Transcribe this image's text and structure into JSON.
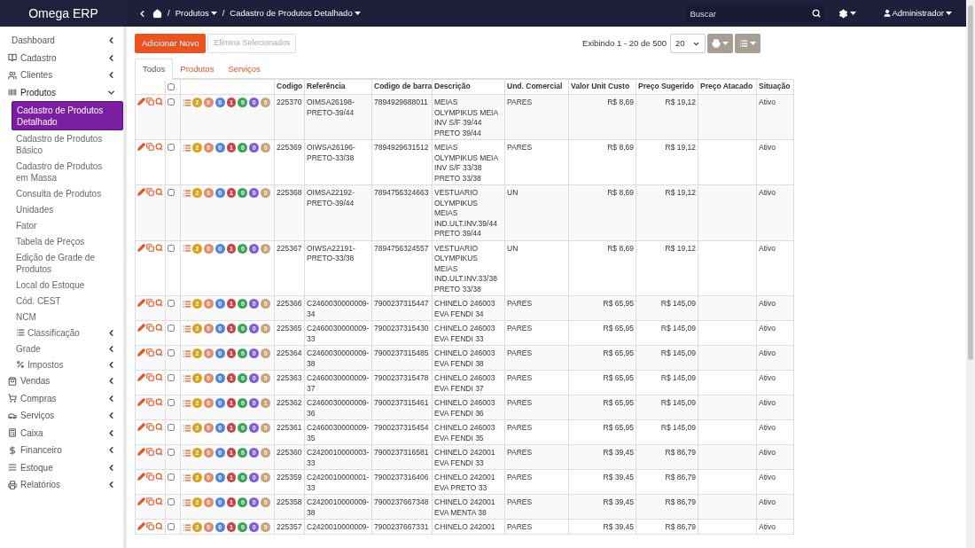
{
  "brand": "Omega ERP",
  "breadcrumb": [
    {
      "separator": "/",
      "label": "Produtos"
    },
    {
      "separator": "/",
      "label": "Cadastro de Produtos Detalhado"
    }
  ],
  "search": {
    "placeholder": "Buscar"
  },
  "user": {
    "name": "Administrador"
  },
  "sidebar": {
    "items": [
      {
        "label": "Dashboard",
        "expanded": false
      },
      {
        "label": "Cadastro",
        "expanded": false
      },
      {
        "label": "Clientes",
        "expanded": false
      },
      {
        "label": "Produtos",
        "expanded": true,
        "children": [
          {
            "label": "Cadastro de Produtos Detalhado",
            "selected": true
          },
          {
            "label": "Cadastro de Produtos Básico",
            "selected": false
          },
          {
            "label": "Cadastro de Produtos em Massa",
            "selected": false
          },
          {
            "label": "Consulta de Produtos",
            "selected": false
          },
          {
            "label": "Unidades",
            "selected": false
          },
          {
            "label": "Fator",
            "selected": false
          },
          {
            "label": "Tabela de Preços",
            "selected": false
          },
          {
            "label": "Edição de Grade de Produtos",
            "selected": false
          },
          {
            "label": "Local do Estoque",
            "selected": false
          },
          {
            "label": "Cód. CEST",
            "selected": false
          },
          {
            "label": "NCM",
            "selected": false
          },
          {
            "label": "Classificação",
            "selected": false,
            "expanded": false
          },
          {
            "label": "Grade",
            "selected": false,
            "expanded": false
          },
          {
            "label": "Impostos",
            "selected": false,
            "expanded": false
          }
        ]
      },
      {
        "label": "Vendas",
        "expanded": false
      },
      {
        "label": "Compras",
        "expanded": false
      },
      {
        "label": "Serviços",
        "expanded": false
      },
      {
        "label": "Caixa",
        "expanded": false
      },
      {
        "label": "Financeiro",
        "expanded": false
      },
      {
        "label": "Estoque",
        "expanded": false
      },
      {
        "label": "Relatórios",
        "expanded": false
      }
    ]
  },
  "toolbar": {
    "add_button": {
      "label": "Adicionar Novo"
    },
    "delete_button": {
      "label": "Elimina Selecionados",
      "disabled": true
    },
    "showing": "Exibindo 1 - 20 de 500",
    "page_size": "20"
  },
  "tabs": [
    {
      "label": "Todos",
      "selected": true
    },
    {
      "label": "Produtos",
      "selected": false
    },
    {
      "label": "Serviços",
      "selected": false
    }
  ],
  "table": {
    "columns": [
      "Codigo",
      "Referência",
      "Codigo de barra",
      "Descrição",
      "Und. Comercial",
      "Valor Unit Custo",
      "Preço Sugerido",
      "Preço Atacado",
      "Situação"
    ],
    "header_checked": false,
    "rows": [
      {
        "checked": false,
        "badges": [
          {
            "count": "2",
            "color": "#d9a21b"
          },
          {
            "count": "0",
            "color": "#e38b6d"
          },
          {
            "count": "0",
            "color": "#4f86e0"
          },
          {
            "count": "1",
            "color": "#c64545"
          },
          {
            "count": "0",
            "color": "#3aa35a"
          },
          {
            "count": "0",
            "color": "#7c5ce0"
          },
          {
            "count": "0",
            "color": "#c9a27a"
          }
        ],
        "codigo": "225370",
        "referencia": "OIMSA26198-PRETO-39/44",
        "barra": "7894929688011",
        "descricao": "MEIAS OLYMPIKUS MEIA INV S/F 39/44 PRETO 39/44",
        "und": "PARES",
        "custo": "R$ 8,69",
        "sugerido": "R$ 19,12",
        "situacao": "Ativo"
      },
      {
        "checked": false,
        "badges": [
          {
            "count": "2",
            "color": "#d9a21b"
          },
          {
            "count": "0",
            "color": "#e38b6d"
          },
          {
            "count": "0",
            "color": "#4f86e0"
          },
          {
            "count": "1",
            "color": "#c64545"
          },
          {
            "count": "0",
            "color": "#3aa35a"
          },
          {
            "count": "0",
            "color": "#7c5ce0"
          },
          {
            "count": "0",
            "color": "#c9a27a"
          }
        ],
        "codigo": "225369",
        "referencia": "OIWSA26196-PRETO-33/38",
        "barra": "7894929631512",
        "descricao": "MEIAS OLYMPIKUS MEIA INV S/F 33/38 PRETO 33/38",
        "und": "PARES",
        "custo": "R$ 8,69",
        "sugerido": "R$ 19,12",
        "situacao": "Ativo"
      },
      {
        "checked": false,
        "badges": [
          {
            "count": "2",
            "color": "#d9a21b"
          },
          {
            "count": "0",
            "color": "#e38b6d"
          },
          {
            "count": "0",
            "color": "#4f86e0"
          },
          {
            "count": "1",
            "color": "#c64545"
          },
          {
            "count": "0",
            "color": "#3aa35a"
          },
          {
            "count": "0",
            "color": "#7c5ce0"
          },
          {
            "count": "0",
            "color": "#c9a27a"
          }
        ],
        "codigo": "225368",
        "referencia": "OIMSA22192-PRETO-39/44",
        "barra": "7894756324663",
        "descricao": "VESTUARIO OLYMPIKUS MEIAS IND.ULT.INV.39/44 PRETO 39/44",
        "und": "UN",
        "custo": "R$ 8,69",
        "sugerido": "R$ 19,12",
        "situacao": "Ativo"
      },
      {
        "checked": false,
        "badges": [
          {
            "count": "2",
            "color": "#d9a21b"
          },
          {
            "count": "0",
            "color": "#e38b6d"
          },
          {
            "count": "0",
            "color": "#4f86e0"
          },
          {
            "count": "1",
            "color": "#c64545"
          },
          {
            "count": "0",
            "color": "#3aa35a"
          },
          {
            "count": "0",
            "color": "#7c5ce0"
          },
          {
            "count": "0",
            "color": "#c9a27a"
          }
        ],
        "codigo": "225367",
        "referencia": "OIWSA22191-PRETO-33/38",
        "barra": "7894756324557",
        "descricao": "VESTUARIO OLYMPIKUS MEIAS IND.ULT.INV.33/38 PRETO 33/38",
        "und": "UN",
        "custo": "R$ 8,69",
        "sugerido": "R$ 19,12",
        "situacao": "Ativo"
      },
      {
        "checked": false,
        "badges": [
          {
            "count": "2",
            "color": "#d9a21b"
          },
          {
            "count": "0",
            "color": "#e38b6d"
          },
          {
            "count": "0",
            "color": "#4f86e0"
          },
          {
            "count": "1",
            "color": "#c64545"
          },
          {
            "count": "0",
            "color": "#3aa35a"
          },
          {
            "count": "0",
            "color": "#7c5ce0"
          },
          {
            "count": "0",
            "color": "#c9a27a"
          }
        ],
        "codigo": "225366",
        "referencia": "C2460030000009-34",
        "barra": "7900237315447",
        "descricao": "CHINELO 246003 EVA FENDI 34",
        "und": "PARES",
        "custo": "R$ 65,95",
        "sugerido": "R$ 145,09",
        "situacao": "Ativo"
      },
      {
        "checked": false,
        "badges": [
          {
            "count": "2",
            "color": "#d9a21b"
          },
          {
            "count": "0",
            "color": "#e38b6d"
          },
          {
            "count": "0",
            "color": "#4f86e0"
          },
          {
            "count": "1",
            "color": "#c64545"
          },
          {
            "count": "0",
            "color": "#3aa35a"
          },
          {
            "count": "0",
            "color": "#7c5ce0"
          },
          {
            "count": "0",
            "color": "#c9a27a"
          }
        ],
        "codigo": "225365",
        "referencia": "C2460030000009-33",
        "barra": "7900237315430",
        "descricao": "CHINELO 246003 EVA FENDI 33",
        "und": "PARES",
        "custo": "R$ 65,95",
        "sugerido": "R$ 145,09",
        "situacao": "Ativo"
      },
      {
        "checked": false,
        "badges": [
          {
            "count": "2",
            "color": "#d9a21b"
          },
          {
            "count": "0",
            "color": "#e38b6d"
          },
          {
            "count": "0",
            "color": "#4f86e0"
          },
          {
            "count": "1",
            "color": "#c64545"
          },
          {
            "count": "0",
            "color": "#3aa35a"
          },
          {
            "count": "0",
            "color": "#7c5ce0"
          },
          {
            "count": "0",
            "color": "#c9a27a"
          }
        ],
        "codigo": "225364",
        "referencia": "C2460030000009-38",
        "barra": "7900237315485",
        "descricao": "CHINELO 246003 EVA FENDI 38",
        "und": "PARES",
        "custo": "R$ 65,95",
        "sugerido": "R$ 145,09",
        "situacao": "Ativo"
      },
      {
        "checked": false,
        "badges": [
          {
            "count": "2",
            "color": "#d9a21b"
          },
          {
            "count": "0",
            "color": "#e38b6d"
          },
          {
            "count": "0",
            "color": "#4f86e0"
          },
          {
            "count": "1",
            "color": "#c64545"
          },
          {
            "count": "0",
            "color": "#3aa35a"
          },
          {
            "count": "0",
            "color": "#7c5ce0"
          },
          {
            "count": "0",
            "color": "#c9a27a"
          }
        ],
        "codigo": "225363",
        "referencia": "C2460030000009-37",
        "barra": "7900237315478",
        "descricao": "CHINELO 246003 EVA FENDI 37",
        "und": "PARES",
        "custo": "R$ 65,95",
        "sugerido": "R$ 145,09",
        "situacao": "Ativo"
      },
      {
        "checked": false,
        "badges": [
          {
            "count": "2",
            "color": "#d9a21b"
          },
          {
            "count": "0",
            "color": "#e38b6d"
          },
          {
            "count": "0",
            "color": "#4f86e0"
          },
          {
            "count": "1",
            "color": "#c64545"
          },
          {
            "count": "0",
            "color": "#3aa35a"
          },
          {
            "count": "0",
            "color": "#7c5ce0"
          },
          {
            "count": "1",
            "color": "#c9a27a"
          }
        ],
        "codigo": "225362",
        "referencia": "C2460030000009-36",
        "barra": "7900237315461",
        "descricao": "CHINELO 246003 EVA FENDI 36",
        "und": "PARES",
        "custo": "R$ 65,95",
        "sugerido": "R$ 145,09",
        "situacao": "Ativo"
      },
      {
        "checked": false,
        "badges": [
          {
            "count": "2",
            "color": "#d9a21b"
          },
          {
            "count": "0",
            "color": "#e38b6d"
          },
          {
            "count": "0",
            "color": "#4f86e0"
          },
          {
            "count": "1",
            "color": "#c64545"
          },
          {
            "count": "0",
            "color": "#3aa35a"
          },
          {
            "count": "0",
            "color": "#7c5ce0"
          },
          {
            "count": "0",
            "color": "#c9a27a"
          }
        ],
        "codigo": "225361",
        "referencia": "C2460030000009-35",
        "barra": "7900237315454",
        "descricao": "CHINELO 246003 EVA FENDI 35",
        "und": "PARES",
        "custo": "R$ 65,95",
        "sugerido": "R$ 145,09",
        "situacao": "Ativo"
      },
      {
        "checked": false,
        "badges": [
          {
            "count": "2",
            "color": "#d9a21b"
          },
          {
            "count": "0",
            "color": "#e38b6d"
          },
          {
            "count": "0",
            "color": "#4f86e0"
          },
          {
            "count": "1",
            "color": "#c64545"
          },
          {
            "count": "0",
            "color": "#3aa35a"
          },
          {
            "count": "0",
            "color": "#7c5ce0"
          },
          {
            "count": "0",
            "color": "#c9a27a"
          }
        ],
        "codigo": "225360",
        "referencia": "C2420010000003-33",
        "barra": "7900237316581",
        "descricao": "CHINELO 242001 EVA FENDI 33",
        "und": "PARES",
        "custo": "R$ 39,45",
        "sugerido": "R$ 86,79",
        "situacao": "Ativo"
      },
      {
        "checked": false,
        "badges": [
          {
            "count": "2",
            "color": "#d9a21b"
          },
          {
            "count": "0",
            "color": "#e38b6d"
          },
          {
            "count": "0",
            "color": "#4f86e0"
          },
          {
            "count": "1",
            "color": "#c64545"
          },
          {
            "count": "0",
            "color": "#3aa35a"
          },
          {
            "count": "0",
            "color": "#7c5ce0"
          },
          {
            "count": "0",
            "color": "#c9a27a"
          }
        ],
        "codigo": "225359",
        "referencia": "C2420010000001-33",
        "barra": "7900237316406",
        "descricao": "CHINELO 242001 EVA PRETO 33",
        "und": "PARES",
        "custo": "R$ 39,45",
        "sugerido": "R$ 86,79",
        "situacao": "Ativo"
      },
      {
        "checked": false,
        "badges": [
          {
            "count": "2",
            "color": "#d9a21b"
          },
          {
            "count": "0",
            "color": "#e38b6d"
          },
          {
            "count": "0",
            "color": "#4f86e0"
          },
          {
            "count": "1",
            "color": "#c64545"
          },
          {
            "count": "0",
            "color": "#3aa35a"
          },
          {
            "count": "0",
            "color": "#7c5ce0"
          },
          {
            "count": "0",
            "color": "#c9a27a"
          }
        ],
        "codigo": "225358",
        "referencia": "C2420010000009-38",
        "barra": "7900237667348",
        "descricao": "CHINELO 242001 EVA MENTA 38",
        "und": "PARES",
        "custo": "R$ 39,45",
        "sugerido": "R$ 86,79",
        "situacao": "Ativo"
      },
      {
        "checked": false,
        "badges": [
          {
            "count": "2",
            "color": "#d9a21b"
          },
          {
            "count": "0",
            "color": "#e38b6d"
          },
          {
            "count": "0",
            "color": "#4f86e0"
          },
          {
            "count": "1",
            "color": "#c64545"
          },
          {
            "count": "0",
            "color": "#3aa35a"
          },
          {
            "count": "0",
            "color": "#7c5ce0"
          },
          {
            "count": "0",
            "color": "#c9a27a"
          }
        ],
        "codigo": "225357",
        "referencia": "C2420010000009-",
        "barra": "7900237667331",
        "descricao": "CHINELO 242001",
        "und": "PARES",
        "custo": "R$ 39,45",
        "sugerido": "R$ 86,79",
        "situacao": "Ativo"
      }
    ]
  }
}
